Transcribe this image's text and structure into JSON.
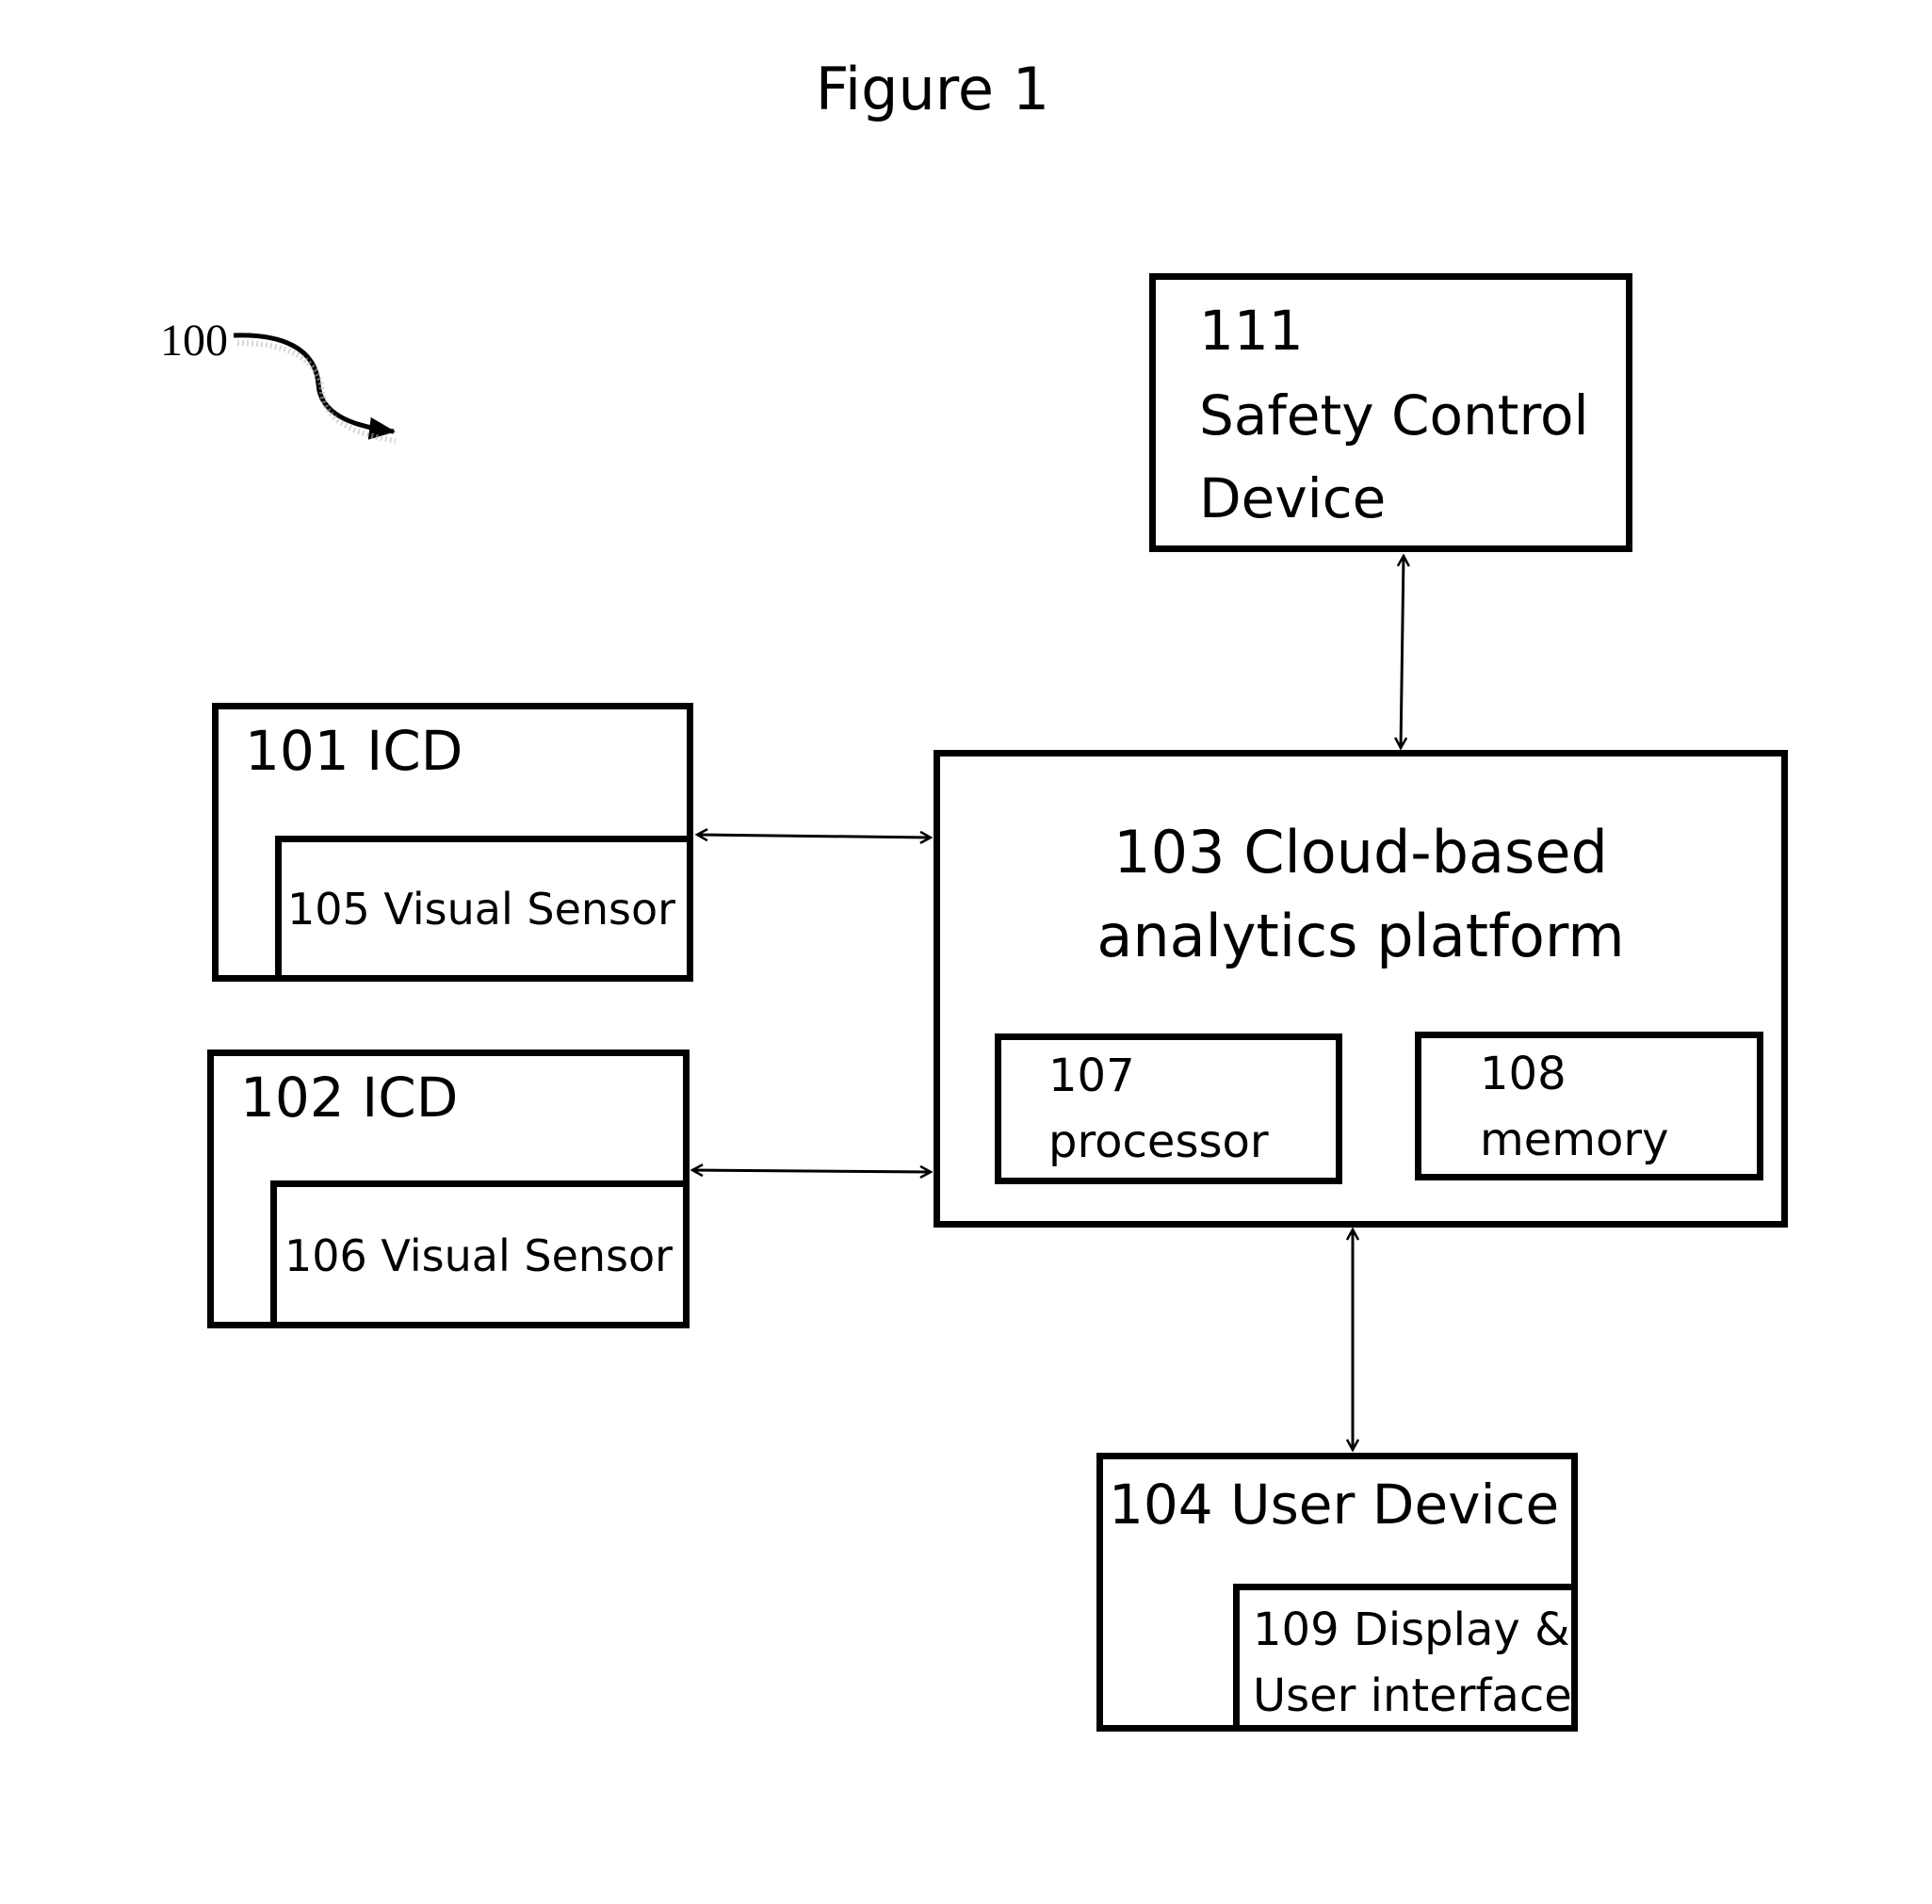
{
  "figure": {
    "title": "Figure 1",
    "reference_numeral": "100"
  },
  "nodes": {
    "safety_control": {
      "number": "111",
      "line1": "Safety Control",
      "line2": "Device"
    },
    "icd_101": {
      "label": "101 ICD",
      "sensor": "105 Visual Sensor"
    },
    "icd_102": {
      "label": "102 ICD",
      "sensor": "106 Visual Sensor"
    },
    "platform": {
      "line1": "103 Cloud-based",
      "line2": "analytics platform",
      "processor": {
        "number": "107",
        "label": "processor"
      },
      "memory": {
        "number": "108",
        "label": "memory"
      }
    },
    "user_device": {
      "label": "104 User Device",
      "display_line1": "109 Display &",
      "display_line2": "User interface"
    }
  },
  "edges": [
    {
      "from": "111 Safety Control Device",
      "to": "103 Cloud-based analytics platform",
      "type": "bidirectional"
    },
    {
      "from": "101 ICD",
      "to": "103 Cloud-based analytics platform",
      "type": "bidirectional"
    },
    {
      "from": "102 ICD",
      "to": "103 Cloud-based analytics platform",
      "type": "bidirectional"
    },
    {
      "from": "107 processor",
      "to": "108 memory",
      "type": "bidirectional"
    },
    {
      "from": "103 Cloud-based analytics platform",
      "to": "104 User Device",
      "type": "bidirectional"
    }
  ]
}
